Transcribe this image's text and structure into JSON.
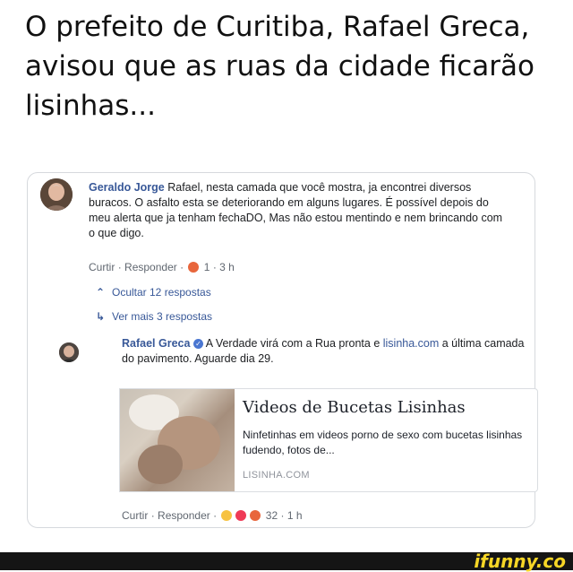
{
  "headline": "O prefeito de Curitiba, Rafael Greca, avisou que as ruas da cidade ficarão lisinhas...",
  "comment1": {
    "author": "Geraldo Jorge",
    "text": " Rafael, nesta camada que você mostra, ja encontrei diversos buracos. O asfalto esta se deteriorando em alguns lugares. É possível depois do meu alerta que ja tenham fechaDO, Mas não estou mentindo e nem brincando com o que digo.",
    "like_label": "Curtir",
    "reply_label": "Responder",
    "reaction_count": "1",
    "time": "3 h"
  },
  "replies": {
    "hide_label": "Ocultar 12 respostas",
    "more_label": "Ver mais 3 respostas"
  },
  "comment2": {
    "author": "Rafael Greca",
    "text_before": " A Verdade virá com a Rua pronta e ",
    "link_text": "lisinha.com",
    "text_after": " a última camada do pavimento. Aguarde dia 29.",
    "like_label": "Curtir",
    "reply_label": "Responder",
    "reaction_count": "32",
    "time": "1 h"
  },
  "link_preview": {
    "title": "Videos de Bucetas Lisinhas",
    "description": "Ninfetinhas em videos porno de sexo com bucetas lisinhas fudendo, fotos de...",
    "domain": "LISINHA.COM"
  },
  "brand": "ifunny.co",
  "colors": {
    "link": "#385898",
    "meta": "#606770",
    "brand_yellow": "#f7d626"
  }
}
